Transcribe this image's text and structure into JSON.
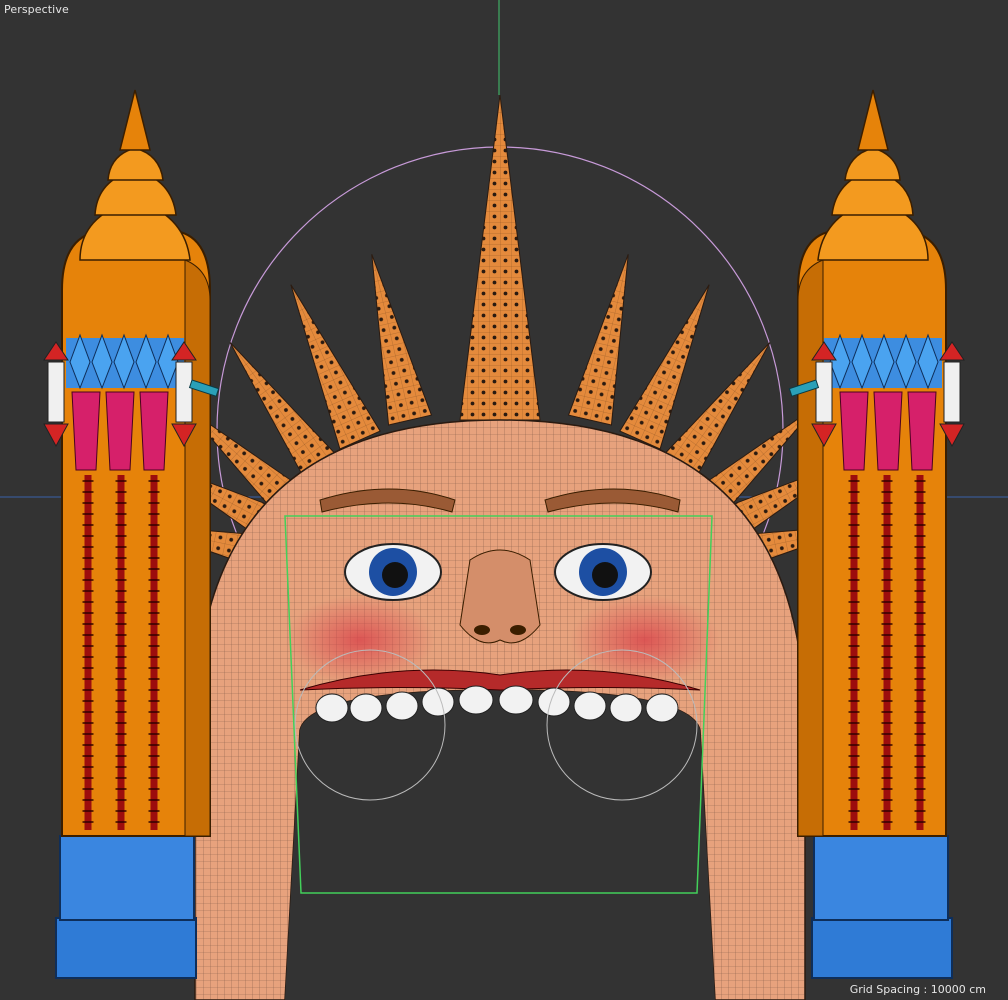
{
  "viewport": {
    "name": "Perspective",
    "grid_spacing_label": "Grid Spacing : 10000 cm"
  },
  "colors": {
    "background": "#333333",
    "axis_y": "#3fae63",
    "axis_x": "#3a62a8",
    "spike_orange": "#e48a3c",
    "skin": "#e7a27d",
    "tower_orange": "#e6830a",
    "tower_blue": "#2f7bd6",
    "pink": "#d6206a",
    "selection_green": "#43d05a",
    "gizmo_pink": "#c79ad8"
  },
  "scene": {
    "objects": [
      "left-tower",
      "right-tower",
      "sun-crown",
      "face",
      "arch-mouth"
    ]
  }
}
